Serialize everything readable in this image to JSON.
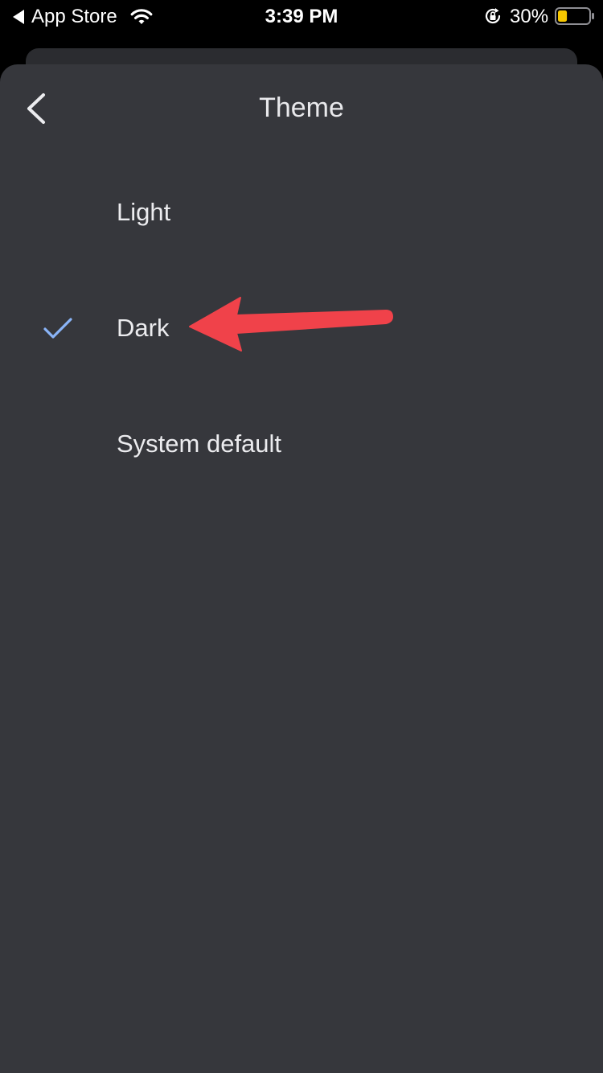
{
  "status_bar": {
    "back_app": "App Store",
    "time": "3:39 PM",
    "battery_percent": "30%",
    "battery_level": 0.3,
    "battery_color": "#f7c800",
    "icons": [
      "back-triangle-icon",
      "wifi-icon",
      "orientation-lock-icon",
      "battery-icon"
    ]
  },
  "header": {
    "title": "Theme",
    "back_icon": "chevron-left-icon"
  },
  "options": [
    {
      "label": "Light",
      "selected": false
    },
    {
      "label": "Dark",
      "selected": true
    },
    {
      "label": "System default",
      "selected": false
    }
  ],
  "colors": {
    "sheet_background": "#36373c",
    "check_color": "#8ab4f8",
    "annotation_arrow": "#f0424a"
  }
}
